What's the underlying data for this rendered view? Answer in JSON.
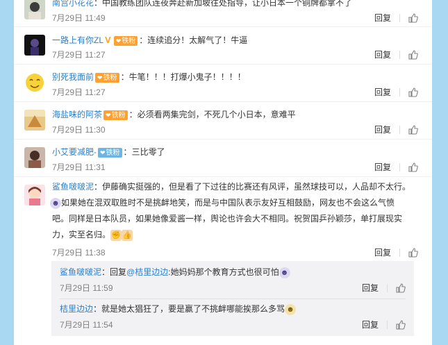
{
  "comments": [
    {
      "user": "南宫小花花",
      "sep": "：",
      "text": "中国教练团队连夜奔赴新加坡往处指导，让小日本一个铜牌都拿不了",
      "time": "7月29日 11:49",
      "reply": "回复"
    },
    {
      "user": "一路上有你ZL",
      "badge": "铁粉",
      "sep": "：",
      "text": "连续追分！太解气了！牛逼",
      "time": "7月29日 11:27",
      "reply": "回复"
    },
    {
      "user": "别死我面前",
      "badge": "铁粉",
      "sep": "：",
      "text": "牛笔！！！打爆小鬼子！！！！",
      "time": "7月29日 11:27",
      "reply": "回复"
    },
    {
      "user": "海盐味的阿茶",
      "badge": "铁粉",
      "sep": "：",
      "text": "必须看两集完剑，不死几个小日本，意难平",
      "time": "7月29日 11:30",
      "reply": "回复"
    },
    {
      "user": "小艾要减肥-",
      "badge": "铁粉",
      "sep": "：",
      "text": "三比零了",
      "time": "7月29日 11:31",
      "reply": "回复"
    },
    {
      "user": "鲨鱼啵啵泥",
      "sep": "：",
      "line1": "伊藤确实挺强的，但是看了下过往的比赛还有风评，虽然球技可以，人品却不太行。",
      "line2": "如果她在混双取胜时不是挑衅地笑，而是与中国队表示友好互相鼓励，网友也不会这么气愤",
      "line3": "吧。同样是日本队员，如果她像爱酱一样，舆论也许会大不相同。祝贺国乒孙颖莎，单打展现实",
      "line4": "力，实至名归。",
      "time": "7月29日 11:38",
      "reply": "回复"
    }
  ],
  "subreplies": [
    {
      "user": "鲨鱼啵啵泥",
      "sep": "：",
      "prefix": "回复",
      "mention": "@桔里边边",
      "text": ":她妈妈那个教育方式也很可怕",
      "time": "7月29日 11:59",
      "reply": "回复"
    },
    {
      "user": "桔里边边",
      "sep": "：",
      "text": "就是她太猖狂了，要是赢了不挑衅哪能挨那么多骂",
      "time": "7月29日 11:54",
      "reply": "回复"
    }
  ],
  "icons": {
    "thumb": "thumbs-up-icon",
    "vip_v": "V",
    "vip_color": "#ffa31a",
    "badge_icon": "fan-badge-icon"
  },
  "colors": {
    "username": "#eb7350",
    "link": "#2d7fc8",
    "background": "#a9d8f2"
  }
}
